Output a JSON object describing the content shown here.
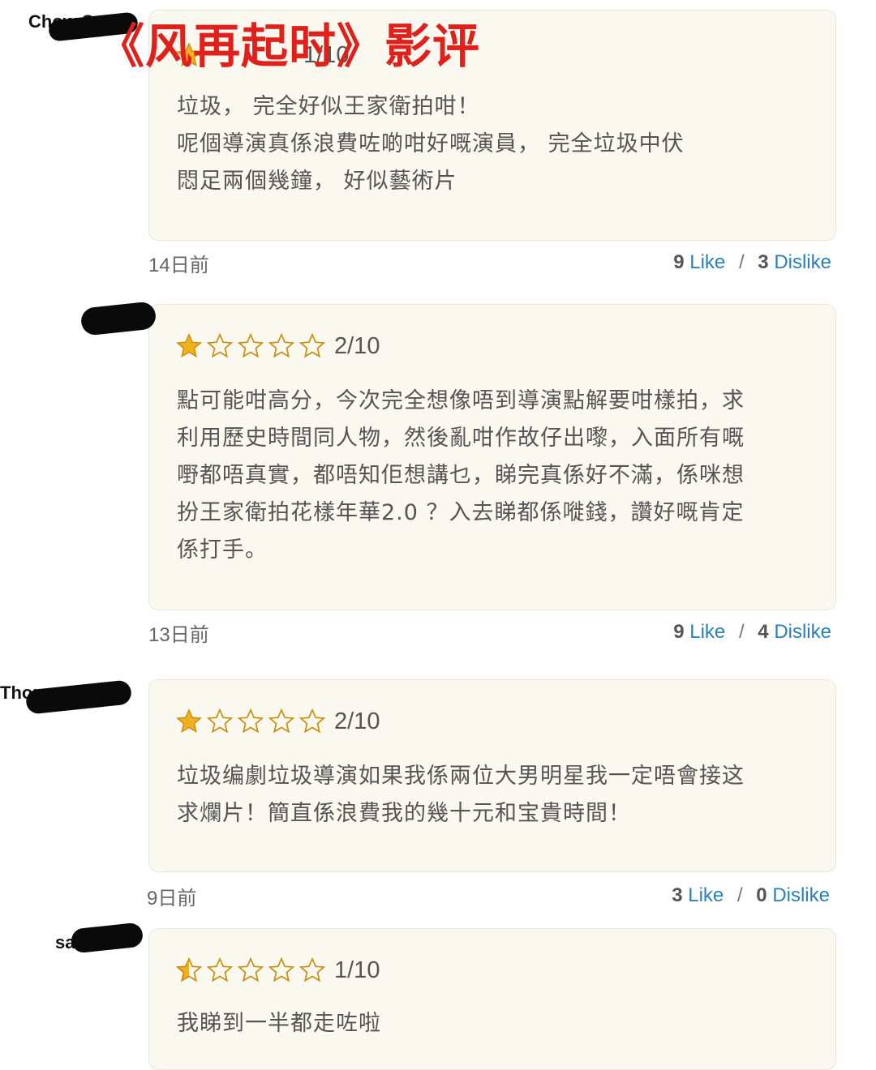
{
  "overlay_title": "《风再起时》影评",
  "reviews": [
    {
      "reviewer": "Chow Sam",
      "score": "1/10",
      "text": [
        "垃圾， 完全好似王家衛拍咁！",
        "呢個導演真係浪費咗啲咁好嘅演員， 完全垃圾中伏",
        "悶足兩個幾鐘， 好似藝術片"
      ],
      "date": "14日前",
      "likes": "9",
      "like_label": "Like",
      "dislikes": "3",
      "dislike_label": "Dislike",
      "stars_filled": 1
    },
    {
      "reviewer": "",
      "score": "2/10",
      "text": [
        "點可能咁高分，今次完全想像唔到導演點解要咁樣拍，求",
        "利用歷史時間同人物，然後亂咁作故仔出嚟，入面所有嘅",
        "嘢都唔真實，都唔知佢想講乜，睇完真係好不滿，係咪想",
        "扮王家衛拍花樣年華2.0 ？入去睇都係嘥錢，讚好嘅肯定",
        "係打手。"
      ],
      "date": "13日前",
      "likes": "9",
      "like_label": "Like",
      "dislikes": "4",
      "dislike_label": "Dislike",
      "stars_filled": 1
    },
    {
      "reviewer": "Thomas Leick",
      "score": "2/10",
      "text": [
        "垃圾编劇垃圾導演如果我係兩位大男明星我一定唔會接这",
        "求爛片！簡直係浪費我的幾十元和宝貴時間！"
      ],
      "date": "9日前",
      "likes": "3",
      "like_label": "Like",
      "dislikes": "0",
      "dislike_label": "Dislike",
      "stars_filled": 1
    },
    {
      "reviewer": "sa",
      "score": "1/10",
      "text": [
        "我睇到一半都走咗啦"
      ],
      "stars_filled": 0.5
    }
  ],
  "colors": {
    "overlay": "#e0211b",
    "link": "#2a7fbd",
    "star": "#f2b01e",
    "card": "#fbf8ef"
  }
}
